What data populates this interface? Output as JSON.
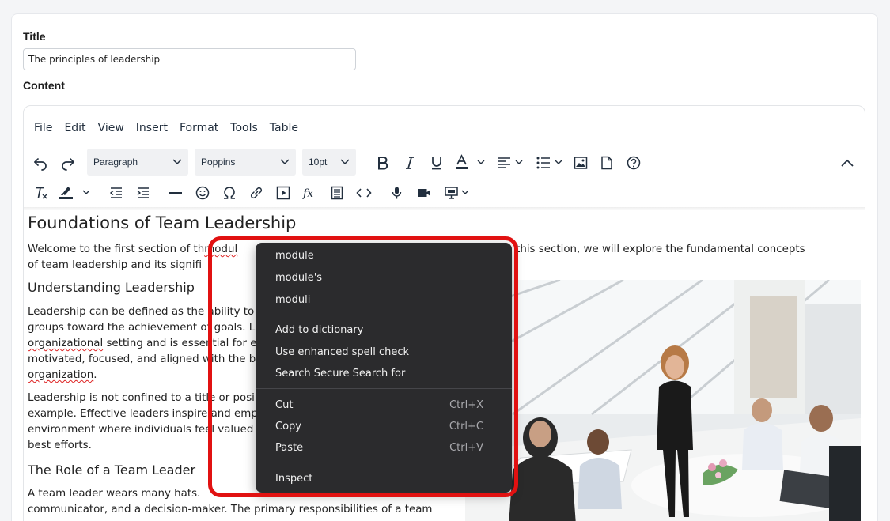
{
  "form": {
    "title_label": "Title",
    "title_value": "The principles of leadership",
    "content_label": "Content"
  },
  "editor": {
    "menubar": [
      "File",
      "Edit",
      "View",
      "Insert",
      "Format",
      "Tools",
      "Table"
    ],
    "toolbar": {
      "block_format": "Paragraph",
      "font_family": "Poppins",
      "font_size": "10pt"
    },
    "icons_row1": [
      "undo-icon",
      "redo-icon",
      "bold-icon",
      "italic-icon",
      "underline-icon",
      "text-color-icon",
      "align-icon",
      "bullet-list-icon",
      "image-icon",
      "document-icon",
      "help-icon",
      "collapse-toolbar-icon"
    ],
    "icons_row2": [
      "clear-formatting-icon",
      "highlight-color-icon",
      "outdent-icon",
      "indent-icon",
      "horizontal-rule-icon",
      "emoji-icon",
      "special-character-icon",
      "link-icon",
      "media-icon",
      "formula-icon",
      "template-icon",
      "source-code-icon",
      "voice-icon",
      "video-icon",
      "presentation-icon"
    ]
  },
  "document": {
    "h1": "Foundations of Team Leadership",
    "p1": {
      "line1_before": "Welcome to the first section of th",
      "line1_typo": "modul",
      "line1_after": "on. In this section, we will explore the fundamental concepts",
      "line2": "of team leadership and its signifi"
    },
    "h2_understanding": "Understanding Leadership",
    "p2": {
      "line1": "Leadership can be defined as the ability to",
      "line2": "groups toward the achievement of goals. L",
      "line3_typo": "organizational",
      "line3_rest": " setting and is essential for e",
      "line4": "motivated, focused, and aligned with the b",
      "line5_typo": "organization",
      "line5_rest": "."
    },
    "p3": {
      "line1": "Leadership is not confined to a title or posi",
      "line2": "example. Effective leaders inspire and emp",
      "line3": "environment where individuals feel valued",
      "line4": "best efforts."
    },
    "h2_role": "The Role of a Team Leader",
    "p4": {
      "line1": "A team leader wears many hats.",
      "line2": "communicator, and a decision-maker. The primary responsibilities of a team"
    }
  },
  "context_menu": {
    "suggestions": [
      "module",
      "module's",
      "moduli"
    ],
    "spell_actions": [
      "Add to dictionary",
      "Use enhanced spell check",
      "Search Secure Search for"
    ],
    "edit_actions": [
      {
        "label": "Cut",
        "shortcut": "Ctrl+X"
      },
      {
        "label": "Copy",
        "shortcut": "Ctrl+C"
      },
      {
        "label": "Paste",
        "shortcut": "Ctrl+V"
      }
    ],
    "inspect_label": "Inspect"
  },
  "colors": {
    "highlight_border": "#e11111",
    "menu_background": "#2b2b2d",
    "spell_error": "#dd2222"
  }
}
